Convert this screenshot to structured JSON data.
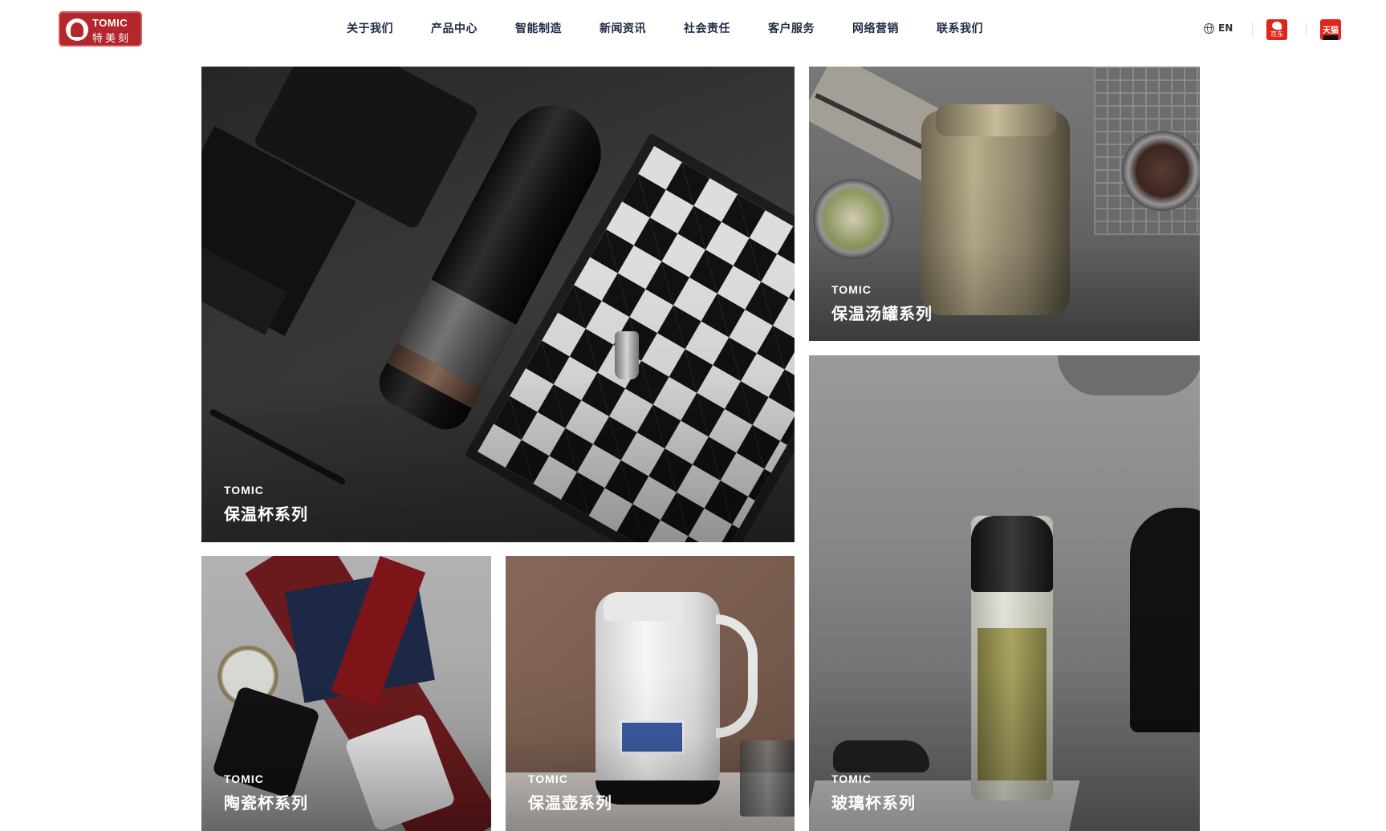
{
  "header": {
    "logo": {
      "word": "TOMIC",
      "cn": "特美刻"
    },
    "nav": [
      {
        "label": "关于我们"
      },
      {
        "label": "产品中心"
      },
      {
        "label": "智能制造"
      },
      {
        "label": "新闻资讯"
      },
      {
        "label": "社会责任"
      },
      {
        "label": "客户服务"
      },
      {
        "label": "网络营销"
      },
      {
        "label": "联系我们"
      }
    ],
    "language": "EN",
    "jd_label": "京东",
    "tmall_label": "天猫"
  },
  "tiles": {
    "cup": {
      "brand": "TOMIC",
      "title": "保温杯系列"
    },
    "jar": {
      "brand": "TOMIC",
      "title": "保温汤罐系列"
    },
    "mug": {
      "brand": "TOMIC",
      "title": "陶瓷杯系列"
    },
    "pot": {
      "brand": "TOMIC",
      "title": "保温壶系列"
    },
    "glass": {
      "brand": "TOMIC",
      "title": "玻璃杯系列"
    }
  },
  "colors": {
    "brand_red": "#b3262b",
    "nav_text": "#1f2a44",
    "jd_red": "#e1251b",
    "tmall_red": "#e1251b"
  },
  "icons": [
    "globe-icon",
    "jd-icon",
    "tmall-icon"
  ]
}
